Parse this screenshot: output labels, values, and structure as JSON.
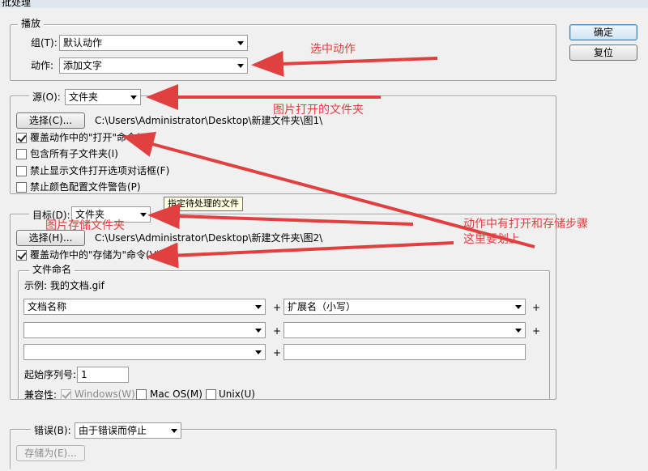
{
  "window": {
    "title": "批处理"
  },
  "buttons": {
    "ok": "确定",
    "reset": "复位"
  },
  "play": {
    "legend": "播放",
    "set_label": "组(T):",
    "set_value": "默认动作",
    "action_label": "动作:",
    "action_value": "添加文字"
  },
  "source": {
    "label": "源(O):",
    "value": "文件夹",
    "choose_button": "选择(C)...",
    "path": "C:\\Users\\Administrator\\Desktop\\新建文件夹\\图1\\",
    "checkboxes": [
      {
        "label": "覆盖动作中的\"打开\"命令(R)",
        "checked": true
      },
      {
        "label": "包含所有子文件夹(I)",
        "checked": false
      },
      {
        "label": "禁止显示文件打开选项对话框(F)",
        "checked": false
      },
      {
        "label": "禁止颜色配置文件警告(P)",
        "checked": false
      }
    ]
  },
  "tooltip": "指定待处理的文件",
  "destination": {
    "label": "目标(D):",
    "value": "文件夹",
    "choose_button": "选择(H)...",
    "path": "C:\\Users\\Administrator\\Desktop\\新建文件夹\\图2\\",
    "override_save": {
      "label": "覆盖动作中的\"存储为\"命令(V)",
      "checked": true
    }
  },
  "file_naming": {
    "legend": "文件命名",
    "example": "示例: 我的文档.gif",
    "rows": [
      {
        "left": "文档名称",
        "right": "扩展名（小写）"
      },
      {
        "left": "",
        "right": ""
      },
      {
        "left": "",
        "right": ""
      }
    ],
    "plus": "+",
    "start_serial_label": "起始序列号:",
    "start_serial_value": "1",
    "compat_label": "兼容性:",
    "compat": [
      {
        "label": "Windows(W)",
        "checked": true,
        "disabled": true
      },
      {
        "label": "Mac OS(M)",
        "checked": false,
        "disabled": false
      },
      {
        "label": "Unix(U)",
        "checked": false,
        "disabled": false
      }
    ]
  },
  "errors": {
    "label": "错误(B):",
    "value": "由于错误而停止",
    "save_as_button": "存储为(E)..."
  },
  "annotations": {
    "select_action": "选中动作",
    "source_folder": "图片打开的文件夹",
    "dest_folder": "图片存储文件夹",
    "note_line1": "动作中有打开和存储步骤",
    "note_line2": "这里要划上"
  },
  "colors": {
    "annotation": "#e04040",
    "tooltip_bg": "#ffffe1",
    "dialog_bg": "#f0f0f0"
  }
}
